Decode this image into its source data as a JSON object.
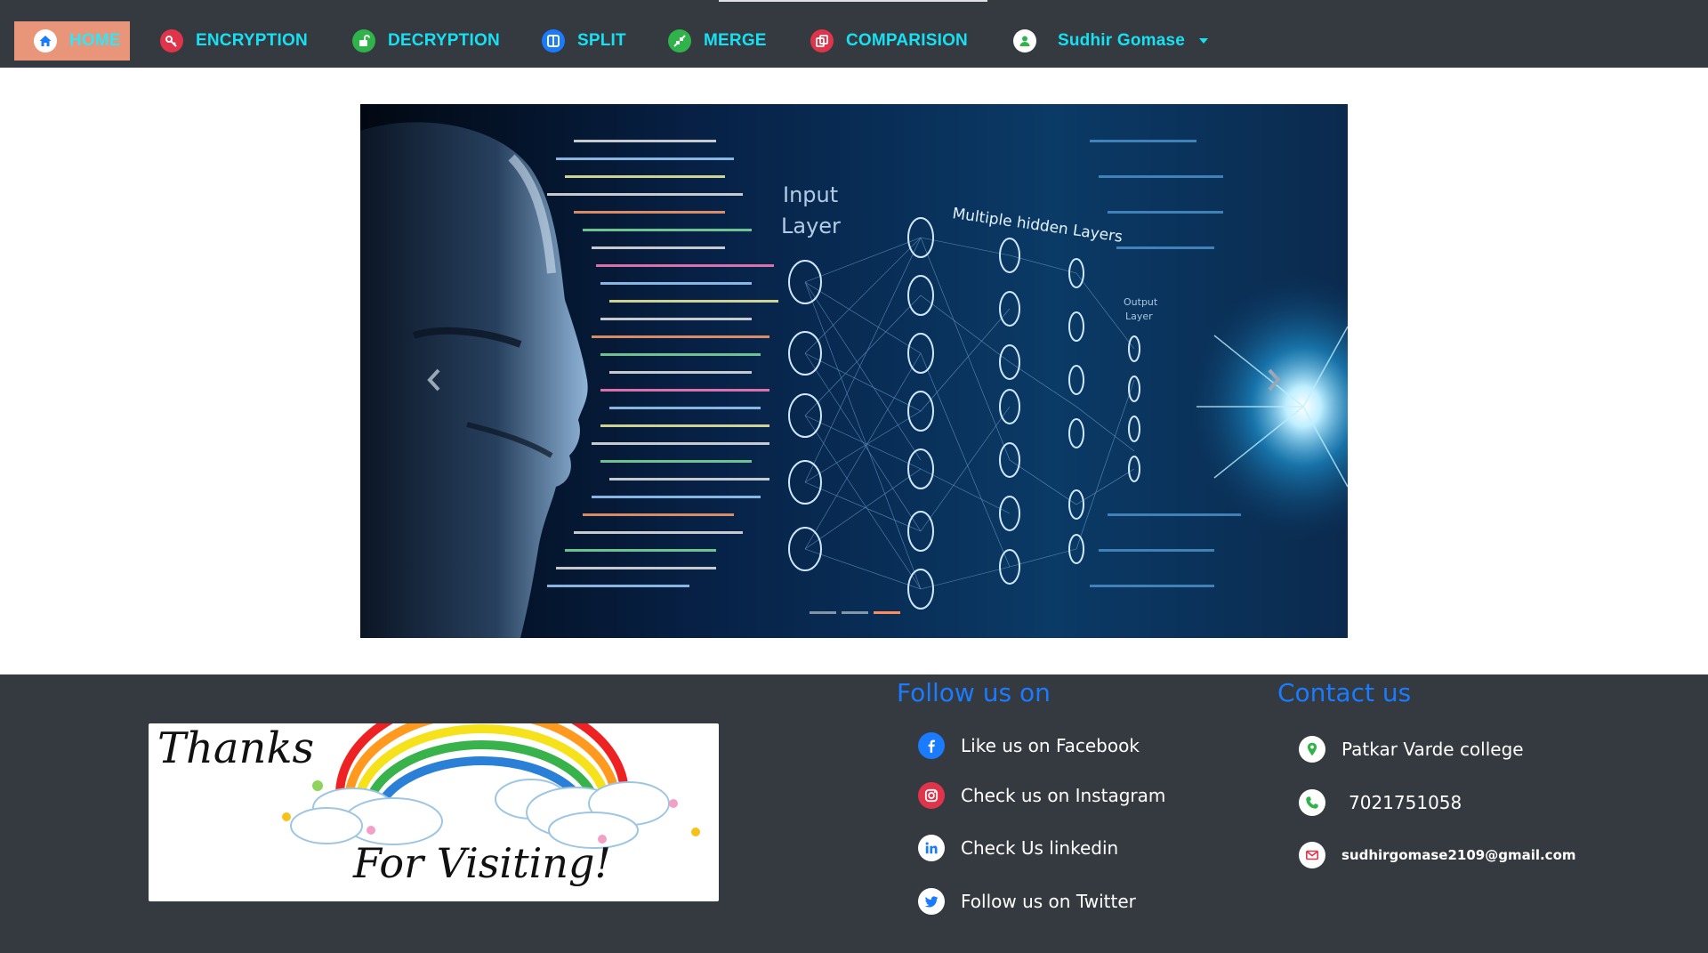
{
  "nav": {
    "items": [
      {
        "label": "HOME",
        "icon": "home-icon",
        "active": true
      },
      {
        "label": "ENCRYPTION",
        "icon": "key-icon"
      },
      {
        "label": "DECRYPTION",
        "icon": "unlock-icon"
      },
      {
        "label": "SPLIT",
        "icon": "split-icon"
      },
      {
        "label": "MERGE",
        "icon": "merge-icon"
      },
      {
        "label": "COMPARISION",
        "icon": "compare-icon"
      }
    ],
    "user": {
      "name": "Sudhir Gomase",
      "icon": "user-icon"
    }
  },
  "carousel": {
    "image_labels": {
      "input_layer_1": "Input",
      "input_layer_2": "Layer",
      "hidden_layers": "Multiple hidden Layers",
      "output_layer_1": "Output",
      "output_layer_2": "Layer"
    },
    "indicator_count": 3,
    "active_indicator": 3
  },
  "footer": {
    "thanks_image": {
      "line1": "Thanks",
      "line2": "For Visiting!"
    },
    "follow": {
      "title": "Follow us on",
      "items": [
        {
          "label": "Like us on Facebook",
          "icon": "facebook-icon"
        },
        {
          "label": "Check us on Instagram",
          "icon": "instagram-icon"
        },
        {
          "label": "Check Us linkedin",
          "icon": "linkedin-icon"
        },
        {
          "label": "Follow us on Twitter",
          "icon": "twitter-icon"
        }
      ]
    },
    "contact": {
      "title": "Contact us",
      "address": "Patkar Varde college",
      "phone": "7021751058",
      "email": "sudhirgomase2109@gmail.com"
    }
  },
  "colors": {
    "navbar_bg": "#343a40",
    "nav_text": "#17e0f2",
    "active_bg": "#e8957a",
    "footer_title": "#1a7bff"
  }
}
